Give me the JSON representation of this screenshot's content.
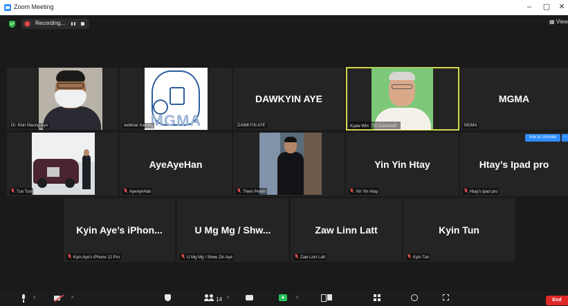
{
  "window": {
    "title": "Zoom Meeting",
    "controls": {
      "minimize": "–",
      "restore": "▢",
      "close": "✕"
    }
  },
  "meeting": {
    "recording_label": "Recording...",
    "view_label": "View"
  },
  "tiles": [
    {
      "id": "dr-khin",
      "big_name": "",
      "nameplate": "Dr. Khin Maung Aye",
      "muted": false,
      "video": true
    },
    {
      "id": "webinar",
      "big_name": "",
      "nameplate": "webinar training",
      "muted": false,
      "video": true,
      "logo_text": "MGMA"
    },
    {
      "id": "dawkyin",
      "big_name": "DAWKYIN AYE",
      "nameplate": "DAWKYIN AYE",
      "muted": false,
      "video": false
    },
    {
      "id": "kyaw-win",
      "big_name": "",
      "nameplate": "Kyaw Win（Tri Diamond）",
      "muted": false,
      "video": true,
      "active_speaker": true
    },
    {
      "id": "mgma",
      "big_name": "MGMA",
      "nameplate": "MGMA",
      "muted": false,
      "video": false
    },
    {
      "id": "tun-tun",
      "big_name": "",
      "nameplate": "Tun Tun",
      "muted": true,
      "video": true
    },
    {
      "id": "ayeayehan",
      "big_name": "AyeAyeHan",
      "nameplate": "AyeAyeHan",
      "muted": true,
      "video": false
    },
    {
      "id": "thein",
      "big_name": "",
      "nameplate": "Thein Pewin",
      "muted": true,
      "video": true
    },
    {
      "id": "yinyin",
      "big_name": "Yin Yin Htay",
      "nameplate": "Yin Yin Htay",
      "muted": true,
      "video": false
    },
    {
      "id": "htay-ipad",
      "big_name": "Htay’s Ipad pro",
      "nameplate": "Htay's Ipad pro",
      "muted": true,
      "video": false
    },
    {
      "id": "kyinaye",
      "big_name": "Kyin Aye’s iPhon...",
      "nameplate": "Kyin Aye's iPhone 12 Pro",
      "muted": true,
      "video": false
    },
    {
      "id": "umgmg",
      "big_name": "U Mg Mg / Shw...",
      "nameplate": "U Mg Mg / Shwe Zin Aye",
      "muted": true,
      "video": false
    },
    {
      "id": "zawlinn",
      "big_name": "Zaw Linn Latt",
      "nameplate": "Zaw Linn Latt",
      "muted": true,
      "video": false
    },
    {
      "id": "kyintun",
      "big_name": "Kyin Tun",
      "nameplate": "Kyin Tun",
      "muted": true,
      "video": false
    }
  ],
  "ask_to_unmute": "Ask to Unmute",
  "more": "···",
  "toolbar": {
    "participants_count": "14",
    "caret": "^",
    "end_label": "End"
  },
  "colors": {
    "brand_blue": "#2d8cff",
    "active_speaker": "#d4d94a",
    "end_red": "#e02828",
    "muted_red": "#e04a4a",
    "share_green": "#26c15b"
  }
}
